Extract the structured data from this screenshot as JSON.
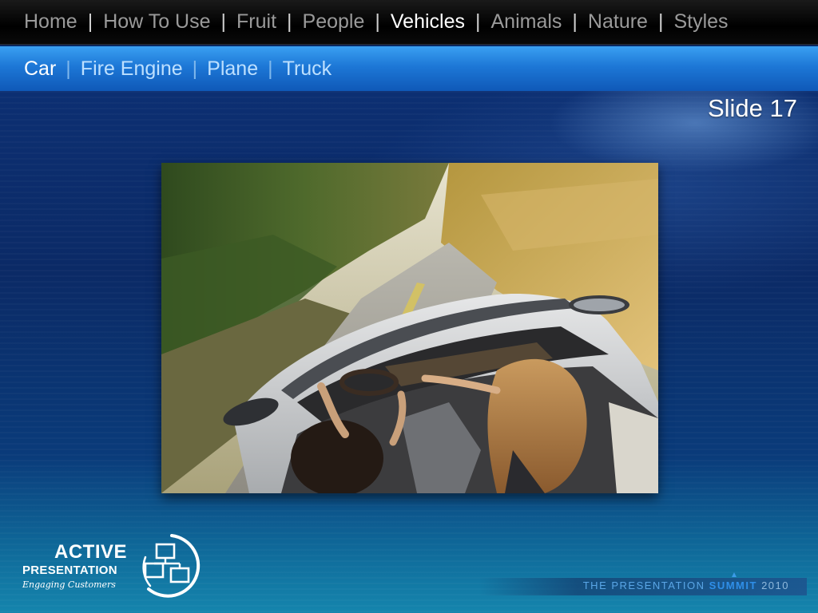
{
  "top_nav": {
    "items": [
      {
        "label": "Home",
        "active": false
      },
      {
        "label": "How To Use",
        "active": false
      },
      {
        "label": "Fruit",
        "active": false
      },
      {
        "label": "People",
        "active": false
      },
      {
        "label": "Vehicles",
        "active": true
      },
      {
        "label": "Animals",
        "active": false
      },
      {
        "label": "Nature",
        "active": false
      },
      {
        "label": "Styles",
        "active": false
      }
    ],
    "separator": "|"
  },
  "sub_nav": {
    "items": [
      {
        "label": "Car",
        "active": true
      },
      {
        "label": "Fire Engine",
        "active": false
      },
      {
        "label": "Plane",
        "active": false
      },
      {
        "label": "Truck",
        "active": false
      }
    ],
    "separator": "|"
  },
  "slide": {
    "label": "Slide 17"
  },
  "photo": {
    "icon": "photo-car-convertible"
  },
  "logo": {
    "line1": "ACTIVE",
    "line2": "PRESENTATION",
    "line3": "Engaging Customers",
    "icon": "network-monitors-icon"
  },
  "summit": {
    "prefix": "THE PRESENTATION",
    "word": "SUMMIT",
    "year": "2010"
  },
  "colors": {
    "top_nav_bg": "#000000",
    "sub_nav_bg": "#1d77d6",
    "stage_bg": "#0b2a66",
    "active_text": "#ffffff",
    "inactive_top": "#9a9a9a",
    "inactive_sub": "#bde0ff"
  }
}
